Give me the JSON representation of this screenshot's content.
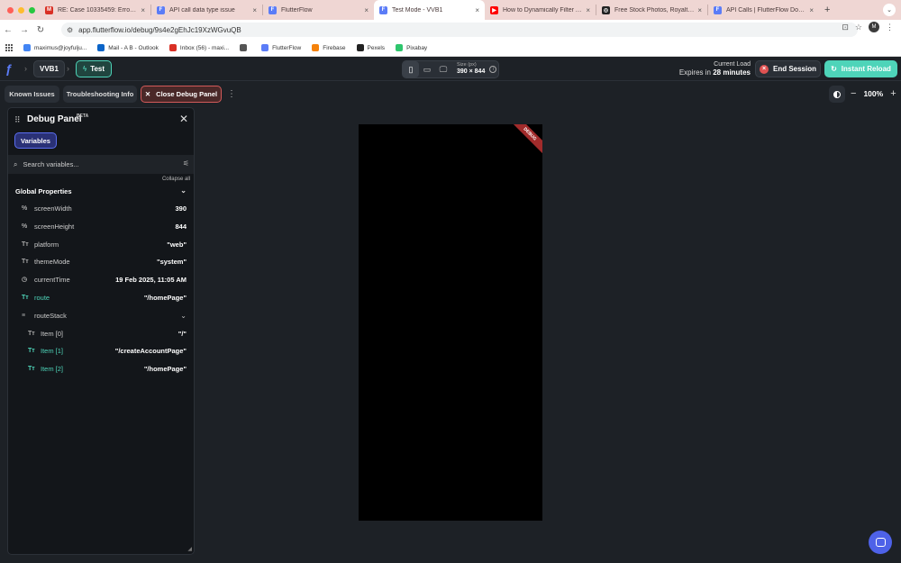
{
  "browser": {
    "tabs": [
      {
        "title": "RE: Case 10335459: Error co",
        "icon": "gmail-icon",
        "color": "#d93025",
        "glyph": "M"
      },
      {
        "title": "API call data type issue",
        "icon": "flutterflow-icon",
        "color": "#5b7cf7",
        "glyph": "F"
      },
      {
        "title": "FlutterFlow",
        "icon": "flutterflow-icon",
        "color": "#5b7cf7",
        "glyph": "F"
      },
      {
        "title": "Test Mode - VVB1",
        "icon": "flutterflow-icon",
        "color": "#5b7cf7",
        "glyph": "F"
      },
      {
        "title": "How to Dynamically Filter API",
        "icon": "youtube-icon",
        "color": "#ff0000",
        "glyph": "▶"
      },
      {
        "title": "Free Stock Photos, Royalty Fr",
        "icon": "pexels-icon",
        "color": "#222222",
        "glyph": "◎"
      },
      {
        "title": "API Calls | FlutterFlow Docum",
        "icon": "flutterflow-icon",
        "color": "#5b7cf7",
        "glyph": "F"
      }
    ],
    "url": "app.flutterflow.io/debug/9s4e2gEhJc19XzWGvuQB",
    "profile_initial": "M",
    "bookmarks": [
      {
        "label": "maximus@joyfulju...",
        "color": "#4285f4"
      },
      {
        "label": "Mail - A B - Outlook",
        "color": "#0a64c8"
      },
      {
        "label": "Inbox (56) - maxi...",
        "color": "#d93025"
      },
      {
        "label": "",
        "color": "#555555"
      },
      {
        "label": "FlutterFlow",
        "color": "#5b7cf7"
      },
      {
        "label": "Firebase",
        "color": "#f5820b"
      },
      {
        "label": "Pexels",
        "color": "#222222"
      },
      {
        "label": "Pixabay",
        "color": "#2ec66d"
      }
    ]
  },
  "header": {
    "project": "VVB1",
    "mode": "Test",
    "size_label": "Size (px)",
    "size_value": "390 × 844",
    "load_label": "Current Load",
    "expires_prefix": "Expires in",
    "expires_value": "28 minutes",
    "end_session": "End Session",
    "instant_reload": "Instant Reload"
  },
  "toolbar": {
    "known_issues": "Known Issues",
    "troubleshooting": "Troubleshooting Info",
    "close_debug": "Close Debug Panel",
    "zoom": "100%"
  },
  "debug_panel": {
    "title": "Debug Panel",
    "badge": "BETA",
    "tab": "Variables",
    "search_placeholder": "Search variables...",
    "collapse_all": "Collapse all",
    "group": "Global Properties",
    "rows": [
      {
        "icon": "%",
        "name": "screenWidth",
        "value": "390",
        "changed": false
      },
      {
        "icon": "%",
        "name": "screenHeight",
        "value": "844",
        "changed": false
      },
      {
        "icon": "Tт",
        "name": "platform",
        "value": "\"web\"",
        "changed": false
      },
      {
        "icon": "Tт",
        "name": "themeMode",
        "value": "\"system\"",
        "changed": false
      },
      {
        "icon": "◷",
        "name": "currentTime",
        "value": "19 Feb 2025, 11:05 AM",
        "changed": false
      },
      {
        "icon": "Tт",
        "name": "route",
        "value": "\"/homePage\"",
        "changed": true
      },
      {
        "icon": "≡",
        "name": "routeStack",
        "value": "",
        "changed": false
      },
      {
        "icon": "Tт",
        "name": "Item [0]",
        "value": "\"/\"",
        "changed": false
      },
      {
        "icon": "Tт",
        "name": "Item [1]",
        "value": "\"/createAccountPage\"",
        "changed": true
      },
      {
        "icon": "Tт",
        "name": "Item [2]",
        "value": "\"/homePage\"",
        "changed": true
      }
    ]
  },
  "preview": {
    "ribbon": "DEBUG"
  }
}
